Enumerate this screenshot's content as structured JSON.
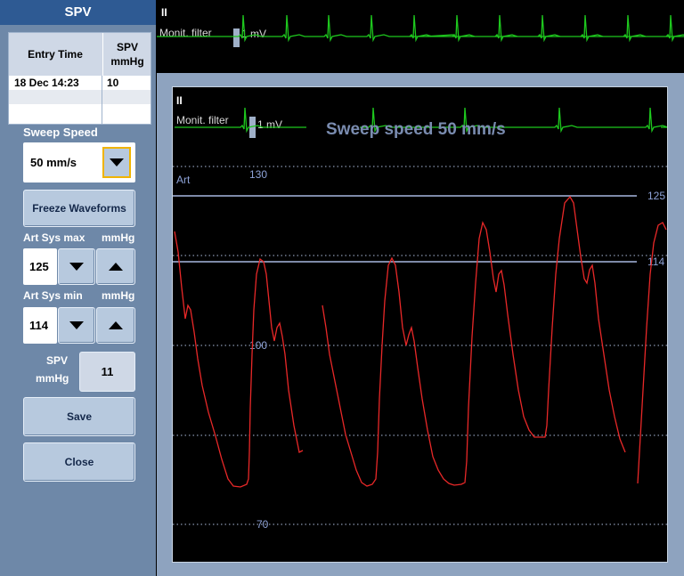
{
  "panel": {
    "title": "SPV",
    "table": {
      "headers": [
        "Entry Time",
        "SPV\nmmHg"
      ],
      "rows": [
        [
          "18 Dec 14:23",
          "10"
        ]
      ]
    },
    "sweep_speed_label": "Sweep Speed",
    "sweep_speed_value": "50 mm/s",
    "freeze_label": "Freeze Waveforms",
    "art_sys_max_label": "Art Sys max",
    "art_sys_max_unit": "mmHg",
    "art_sys_max_value": "125",
    "art_sys_min_label": "Art Sys min",
    "art_sys_min_unit": "mmHg",
    "art_sys_min_value": "114",
    "spv_label": "SPV",
    "spv_unit": "mmHg",
    "spv_value": "11",
    "save_label": "Save",
    "close_label": "Close"
  },
  "top_strip": {
    "lead": "II",
    "filter": "Monit. filter",
    "scale": "1 mV"
  },
  "main_view": {
    "lead": "II",
    "filter": "Monit. filter",
    "scale": "1 mV",
    "sweep_text": "Sweep speed 50 mm/s",
    "art_label": "Art",
    "scale_labels": [
      "130",
      "100",
      "70"
    ],
    "max_line_label": "125",
    "min_line_label": "114"
  },
  "colors": {
    "ecg": "#1ec81e",
    "art": "#e82828",
    "scale": "#8ea3d8",
    "panel": "#6e88a8",
    "title": "#2e5a93"
  }
}
